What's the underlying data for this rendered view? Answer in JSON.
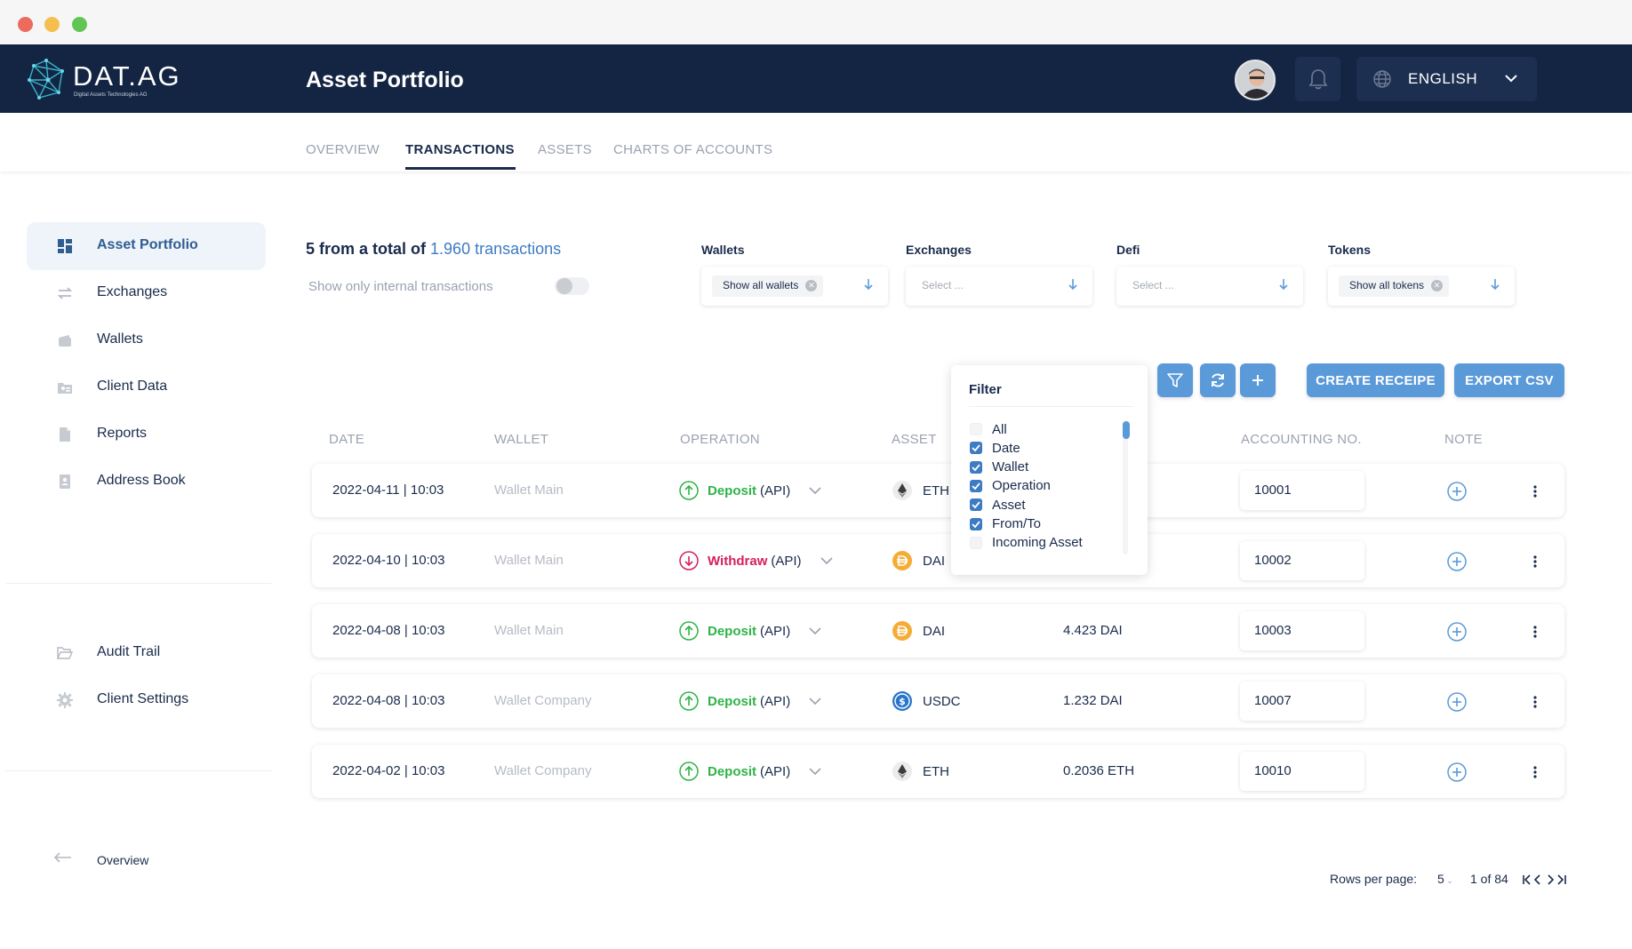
{
  "app": {
    "logo_text": "DAT.AG",
    "logo_subtitle": "Digital Assets Technologies AG",
    "page_title": "Asset Portfolio",
    "language": "ENGLISH"
  },
  "tabs": [
    {
      "label": "OVERVIEW",
      "active": false
    },
    {
      "label": "TRANSACTIONS",
      "active": true
    },
    {
      "label": "ASSETS",
      "active": false
    },
    {
      "label": "CHARTS OF ACCOUNTS",
      "active": false
    }
  ],
  "sidebar": {
    "items": [
      {
        "label": "Asset Portfolio",
        "icon": "dashboard-icon",
        "active": true
      },
      {
        "label": "Exchanges",
        "icon": "exchange-arrows-icon",
        "active": false
      },
      {
        "label": "Wallets",
        "icon": "wallet-icon",
        "active": false
      },
      {
        "label": "Client Data",
        "icon": "client-card-icon",
        "active": false
      },
      {
        "label": "Reports",
        "icon": "document-icon",
        "active": false
      },
      {
        "label": "Address Book",
        "icon": "contact-book-icon",
        "active": false
      }
    ],
    "secondary": [
      {
        "label": "Audit Trail",
        "icon": "folder-open-icon"
      },
      {
        "label": "Client Settings",
        "icon": "gear-icon"
      }
    ],
    "back_link": "Overview"
  },
  "summary": {
    "prefix": "5 from a total of",
    "highlight": "1.960 transactions",
    "internal_label": "Show only internal transactions",
    "internal_on": false
  },
  "filters": {
    "wallets": {
      "label": "Wallets",
      "chip": "Show all wallets",
      "placeholder": ""
    },
    "exchanges": {
      "label": "Exchanges",
      "placeholder": "Select ..."
    },
    "defi": {
      "label": "Defi",
      "placeholder": "Select ..."
    },
    "tokens": {
      "label": "Tokens",
      "chip": "Show all tokens",
      "placeholder": ""
    }
  },
  "actions": {
    "create_receipt": "CREATE RECEIPE",
    "export_csv": "EXPORT CSV"
  },
  "filter_popup": {
    "title": "Filter",
    "options": [
      {
        "label": "All",
        "checked": false
      },
      {
        "label": "Date",
        "checked": true
      },
      {
        "label": "Wallet",
        "checked": true
      },
      {
        "label": "Operation",
        "checked": true
      },
      {
        "label": "Asset",
        "checked": true
      },
      {
        "label": "From/To",
        "checked": true
      },
      {
        "label": "Incoming Asset",
        "checked": false
      }
    ]
  },
  "table": {
    "headers": {
      "date": "DATE",
      "wallet": "WALLET",
      "operation": "OPERATION",
      "asset": "ASSET",
      "accounting": "ACCOUNTING NO.",
      "note": "NOTE"
    },
    "rows": [
      {
        "date": "2022-04-11 | 10:03",
        "wallet": "Wallet Main",
        "op": "Deposit",
        "op_kind": "deposit",
        "src": "(API)",
        "asset": "ETH",
        "asset_icon": "eth-icon",
        "amount": "",
        "acc": "10001"
      },
      {
        "date": "2022-04-10 | 10:03",
        "wallet": "Wallet Main",
        "op": "Withdraw",
        "op_kind": "withdraw",
        "src": "(API)",
        "asset": "DAI",
        "asset_icon": "dai-icon",
        "amount": "",
        "acc": "10002"
      },
      {
        "date": "2022-04-08 | 10:03",
        "wallet": "Wallet Main",
        "op": "Deposit",
        "op_kind": "deposit",
        "src": "(API)",
        "asset": "DAI",
        "asset_icon": "dai-icon",
        "amount": "4.423 DAI",
        "acc": "10003"
      },
      {
        "date": "2022-04-08 | 10:03",
        "wallet": "Wallet Company",
        "op": "Deposit",
        "op_kind": "deposit",
        "src": "(API)",
        "asset": "USDC",
        "asset_icon": "usdc-icon",
        "amount": "1.232 DAI",
        "acc": "10007"
      },
      {
        "date": "2022-04-02 | 10:03",
        "wallet": "Wallet Company",
        "op": "Deposit",
        "op_kind": "deposit",
        "src": "(API)",
        "asset": "ETH",
        "asset_icon": "eth-icon",
        "amount": "0.2036 ETH",
        "acc": "10010"
      }
    ]
  },
  "pagination": {
    "rows_label": "Rows per page:",
    "rows_value": "5",
    "range": "1 of 84"
  },
  "colors": {
    "header_bg": "#142543",
    "accent": "#5b9ad9",
    "deposit": "#2fb348",
    "withdraw": "#d6205c"
  }
}
